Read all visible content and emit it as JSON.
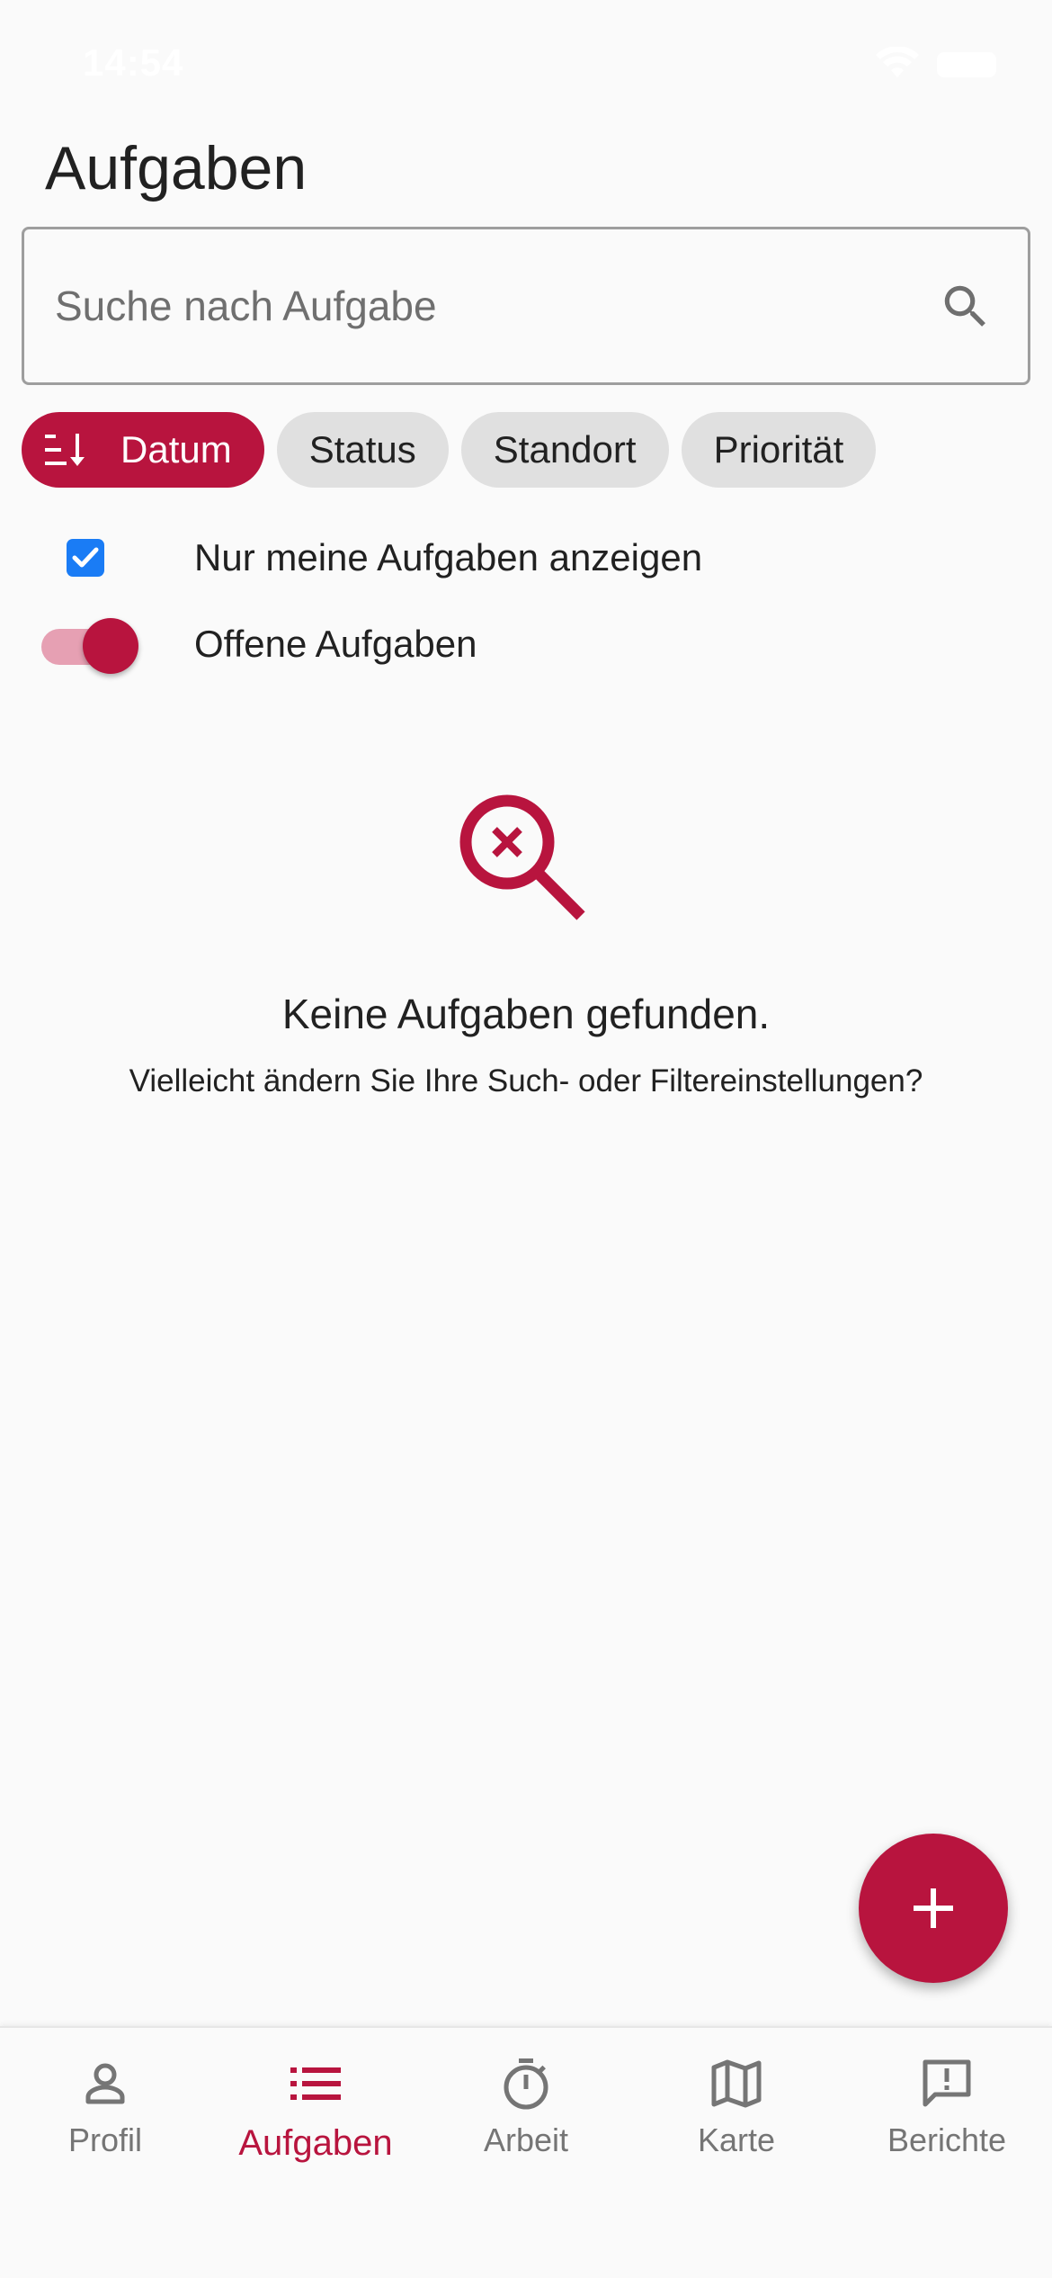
{
  "status_bar": {
    "time": "14:54"
  },
  "page": {
    "title": "Aufgaben"
  },
  "search": {
    "placeholder": "Suche nach Aufgabe",
    "value": ""
  },
  "chips": [
    {
      "label": "Datum",
      "active": true,
      "icon": "sort-icon"
    },
    {
      "label": "Status",
      "active": false
    },
    {
      "label": "Standort",
      "active": false
    },
    {
      "label": "Priorität",
      "active": false
    }
  ],
  "filters": {
    "only_mine": {
      "label": "Nur meine Aufgaben anzeigen",
      "checked": true
    },
    "open_tasks": {
      "label": "Offene Aufgaben",
      "on": true
    }
  },
  "empty_state": {
    "icon": "search-off-icon",
    "title": "Keine Aufgaben gefunden.",
    "subtitle": "Vielleicht ändern Sie Ihre Such- oder Filtereinstellungen?"
  },
  "fab": {
    "icon": "plus-icon"
  },
  "bottom_nav": [
    {
      "label": "Profil",
      "icon": "person-icon",
      "active": false
    },
    {
      "label": "Aufgaben",
      "icon": "list-icon",
      "active": true
    },
    {
      "label": "Arbeit",
      "icon": "timer-icon",
      "active": false
    },
    {
      "label": "Karte",
      "icon": "map-icon",
      "active": false
    },
    {
      "label": "Berichte",
      "icon": "report-icon",
      "active": false
    }
  ],
  "colors": {
    "accent": "#b8143e",
    "chip_bg": "#e0e0e0",
    "checkbox": "#1a7cf5",
    "inactive_nav": "#757575"
  }
}
